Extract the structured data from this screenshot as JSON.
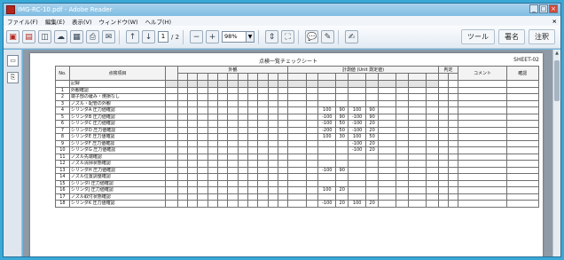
{
  "window": {
    "title": "IMG-RC-10.pdf - Adobe Reader"
  },
  "menubar": [
    "ファイル(F)",
    "編集(E)",
    "表示(V)",
    "ウィンドウ(W)",
    "ヘルプ(H)"
  ],
  "toolbar": {
    "page_current": "1",
    "page_total": "/ 2",
    "zoom": "98%",
    "tools_label": "ツール",
    "sign_label": "署名",
    "comment_label": "注釈"
  },
  "document": {
    "title": "点検一覧チェックシート",
    "code": "SHEET-02",
    "header": {
      "no": "No.",
      "item": "点検項目",
      "group1": "外観",
      "group2": "計測値 (Unit 測定値)",
      "group3": "判定",
      "group4": "コメント",
      "group5": "確認"
    },
    "rows": [
      {
        "no": "",
        "label": "記録",
        "fill": "s"
      },
      {
        "no": "1",
        "label": "外観確認"
      },
      {
        "no": "2",
        "label": "端子部の緩み・焼損なし"
      },
      {
        "no": "3",
        "label": "ノズル・配管の外観"
      },
      {
        "no": "4",
        "label": "シリンダA 圧力値確認",
        "v1": "100",
        "v2": "90",
        "v3": "100",
        "v4": "90"
      },
      {
        "no": "5",
        "label": "シリンダB 圧力値確認",
        "v1": "-100",
        "v2": "90",
        "v3": "-100",
        "v4": "90"
      },
      {
        "no": "6",
        "label": "シリンダC 圧力値確認",
        "v1": "-100",
        "v2": "50",
        "v3": "-100",
        "v4": "20"
      },
      {
        "no": "7",
        "label": "シリンダD 圧力値確認",
        "v1": "-200",
        "v2": "50",
        "v3": "-100",
        "v4": "20"
      },
      {
        "no": "8",
        "label": "シリンダE 圧力値確認",
        "v1": "100",
        "v2": "30",
        "v3": "100",
        "v4": "50"
      },
      {
        "no": "9",
        "label": "シリンダF 圧力値確認",
        "v3": "-100",
        "v4": "20"
      },
      {
        "no": "10",
        "label": "シリンダG 圧力値確認",
        "v3": "-100",
        "v4": "20"
      },
      {
        "no": "11",
        "label": "ノズル先端確認"
      },
      {
        "no": "12",
        "label": "ノズル清掃状態確認"
      },
      {
        "no": "13",
        "label": "シリンダH 圧力値確認",
        "v1": "-100",
        "v2": "90"
      },
      {
        "no": "14",
        "label": "ノズル位置調整確認"
      },
      {
        "no": "15",
        "label": "シリンダI 圧力値確認"
      },
      {
        "no": "16",
        "label": "シリンダJ 圧力値確認",
        "v1": "100",
        "v2": "20"
      },
      {
        "no": "17",
        "label": "ノズル取付状態確認"
      },
      {
        "no": "18",
        "label": "シリンダK 圧力値確認",
        "v1": "-100",
        "v2": "20",
        "v3": "100",
        "v4": "20"
      }
    ]
  },
  "colors": {
    "titlebar": "#7fbde2",
    "desktop": "#3aa9d6"
  }
}
